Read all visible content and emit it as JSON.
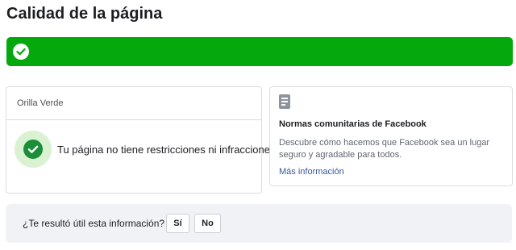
{
  "page": {
    "title": "Calidad de la página"
  },
  "banner": {
    "status_icon": "check-circle-icon",
    "color": "#06a90d"
  },
  "status_card": {
    "page_name": "Orilla Verde",
    "status_text": "Tu página no tiene restricciones ni infracciones",
    "status_icon": "check-circle-icon"
  },
  "info_card": {
    "icon": "document-icon",
    "title": "Normas comunitarias de Facebook",
    "description": "Descubre cómo hacemos que Facebook sea un lugar seguro y agradable para todos.",
    "link": "Más información"
  },
  "feedback": {
    "question": "¿Te resultó útil esta información?",
    "yes_label": "Sí",
    "no_label": "No"
  }
}
